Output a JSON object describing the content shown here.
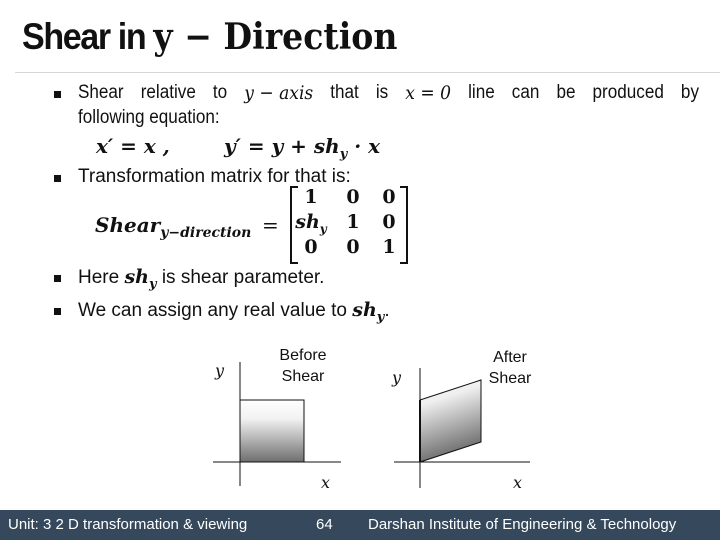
{
  "slide": {
    "title_prefix": "Shear in ",
    "title_var": "y",
    "title_suffix": " − Direction",
    "bullets": [
      {
        "parts": [
          "Shear",
          "relative",
          "to",
          "y − axis",
          "that",
          "is",
          "x = 0",
          "line",
          "can",
          "be",
          "produced",
          "by"
        ],
        "continuation": "following equation:"
      },
      {
        "text": "Transformation matrix for that is:"
      },
      {
        "pre": "Here ",
        "var": "sh",
        "sub": "y",
        "post": " is shear parameter."
      },
      {
        "pre": "We can assign any real value to ",
        "var": "sh",
        "sub": "y",
        "post": "."
      }
    ],
    "equations": {
      "xprime": "x′ = x ,",
      "yprime_lhs": "y′ = y + ",
      "yprime_var": "sh",
      "yprime_sub": "y",
      "yprime_rhs": " · x"
    },
    "matrix": {
      "lhs": "Shear",
      "lhs_sub": "y−direction",
      "equals": "=",
      "rows": [
        [
          "1",
          "0",
          "0"
        ],
        [
          "sh_y",
          "1",
          "0"
        ],
        [
          "0",
          "0",
          "1"
        ]
      ]
    },
    "diagrams": {
      "before": {
        "label_line1": "Before",
        "label_line2": "Shear",
        "x_axis": "x",
        "y_axis": "y"
      },
      "after": {
        "label_line1": "After",
        "label_line2": "Shear",
        "x_axis": "x",
        "y_axis": "y"
      }
    }
  },
  "footer": {
    "unit": "Unit: 3 2 D transformation & viewing",
    "page": "64",
    "institute": "Darshan Institute of Engineering & Technology"
  },
  "colors": {
    "footer_bg": "#35485c",
    "footer_text": "#ffffff",
    "divider": "#d6d6d6"
  }
}
